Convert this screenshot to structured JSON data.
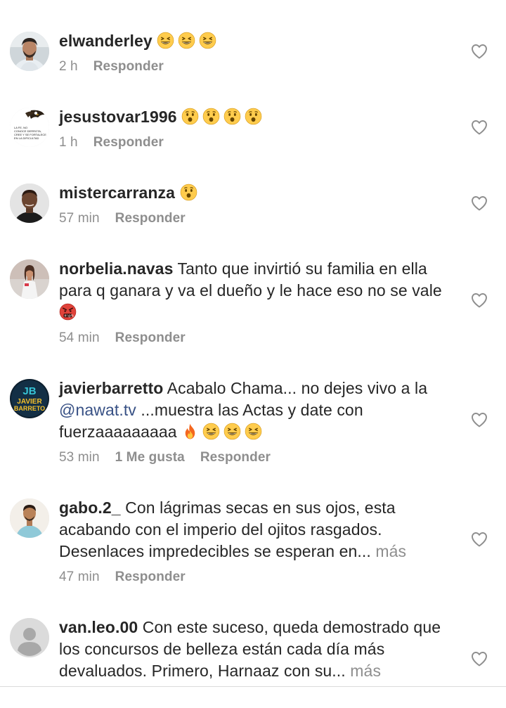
{
  "comments": [
    {
      "username": "elwanderley",
      "text": "",
      "emoji": [
        "grinning-squint-face",
        "grinning-squint-face",
        "grinning-squint-face"
      ],
      "time": "2 h",
      "likes": "",
      "reply_label": "Responder"
    },
    {
      "username": "jesustovar1996",
      "text": "",
      "emoji": [
        "hushed-face",
        "hushed-face",
        "hushed-face",
        "hushed-face"
      ],
      "time": "1 h",
      "likes": "",
      "reply_label": "Responder"
    },
    {
      "username": "mistercarranza",
      "text": "",
      "emoji": [
        "hushed-face"
      ],
      "time": "57 min",
      "likes": "",
      "reply_label": "Responder"
    },
    {
      "username": "norbelia.navas",
      "text": "Tanto que invirtió su familia en ella para q ganara y va el dueño y le hace eso no se vale",
      "emoji": [
        "cursing-face"
      ],
      "time": "54 min",
      "likes": "",
      "reply_label": "Responder"
    },
    {
      "username": "javierbarretto",
      "text_before": "Acabalo Chama... no dejes vivo a la",
      "mention": "@nawat.tv",
      "text_after": "...muestra las Actas y date con fuerzaaaaaaaaa",
      "emoji": [
        "fire",
        "grinning-squint-face",
        "grinning-squint-face",
        "grinning-squint-face"
      ],
      "time": "53 min",
      "likes": "1 Me gusta",
      "reply_label": "Responder"
    },
    {
      "username": "gabo.2_",
      "text": "Con lágrimas secas en sus ojos, esta acabando con el imperio del ojitos rasgados. Desenlaces impredecibles se esperan en...",
      "more": "más",
      "time": "47 min",
      "likes": "",
      "reply_label": "Responder"
    },
    {
      "username": "van.leo.00",
      "text": "Con este suceso, queda demostrado que los concursos de belleza están cada día más devaluados. Primero, Harnaaz con su...",
      "more": "más"
    }
  ],
  "avatar_texts": {
    "jesustovar1996": [
      "LA FE, NO",
      "CONOCE DERROTA,",
      "CREE Y SE FORTALECE",
      "EN LA DIFICULTAD"
    ],
    "javierbarretto": [
      "JB",
      "JAVIER",
      "BARRETO"
    ]
  },
  "colors": {
    "text": "#262626",
    "secondary": "#8e8e8e",
    "mention": "#385185",
    "divider": "#dbdbdb"
  }
}
